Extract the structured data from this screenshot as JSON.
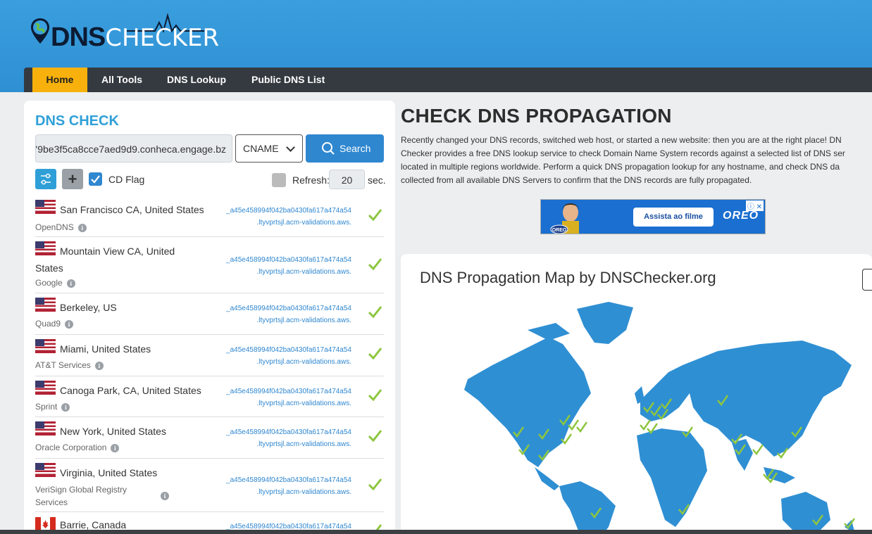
{
  "brand": {
    "dns": "DNS",
    "checker": "CHECKER"
  },
  "nav": {
    "home": "Home",
    "all_tools": "All Tools",
    "dns_lookup": "DNS Lookup",
    "public_dns_list": "Public DNS List"
  },
  "check": {
    "title": "DNS CHECK",
    "domain_value": "'9be3f5ca8cce7aed9d9.conheca.engage.bz",
    "record_type": "CNAME",
    "search_label": "Search",
    "cd_flag_label": "CD Flag",
    "cd_flag_checked": true,
    "refresh_label": "Refresh:",
    "refresh_value": "20",
    "sec_label": "sec."
  },
  "servers": [
    {
      "location": "San Francisco CA, United States",
      "provider": "OpenDNS",
      "country": "us",
      "result_line1": "_a45e458994f042ba0430fa617a474a54",
      "result_line2": ".ltyvprtsjl.acm-validations.aws.",
      "status": "ok"
    },
    {
      "location": "Mountain View CA, United States",
      "provider": "Google",
      "country": "us",
      "result_line1": "_a45e458994f042ba0430fa617a474a54",
      "result_line2": ".ltyvprtsjl.acm-validations.aws.",
      "status": "ok"
    },
    {
      "location": "Berkeley, US",
      "provider": "Quad9",
      "country": "us",
      "result_line1": "_a45e458994f042ba0430fa617a474a54",
      "result_line2": ".ltyvprtsjl.acm-validations.aws.",
      "status": "ok"
    },
    {
      "location": "Miami, United States",
      "provider": "AT&T Services",
      "country": "us",
      "result_line1": "_a45e458994f042ba0430fa617a474a54",
      "result_line2": ".ltyvprtsjl.acm-validations.aws.",
      "status": "ok"
    },
    {
      "location": "Canoga Park, CA, United States",
      "provider": "Sprint",
      "country": "us",
      "result_line1": "_a45e458994f042ba0430fa617a474a54",
      "result_line2": ".ltyvprtsjl.acm-validations.aws.",
      "status": "ok"
    },
    {
      "location": "New York, United States",
      "provider": "Oracle Corporation",
      "country": "us",
      "result_line1": "_a45e458994f042ba0430fa617a474a54",
      "result_line2": ".ltyvprtsjl.acm-validations.aws.",
      "status": "ok"
    },
    {
      "location": "Virginia, United States",
      "provider": "VeriSign Global Registry Services",
      "country": "us",
      "result_line1": "_a45e458994f042ba0430fa617a474a54",
      "result_line2": ".ltyvprtsjl.acm-validations.aws.",
      "status": "ok"
    },
    {
      "location": "Barrie, Canada",
      "provider": "",
      "country": "ca",
      "result_line1": "_a45e458994f042ba0430fa617a474a54",
      "result_line2": "",
      "status": "ok"
    }
  ],
  "main": {
    "title": "CHECK DNS PROPAGATION",
    "desc_line1": "Recently changed your DNS records, switched web host, or started a new website: then you are at the right place! DN",
    "desc_line2": "Checker provides a free DNS lookup service to check Domain Name System records against a selected list of DNS ser",
    "desc_line3": "located in multiple regions worldwide. Perform a quick DNS propagation lookup for any hostname, and check DNS da",
    "desc_line4": "collected from all available DNS Servers to confirm that the DNS records are fully propagated."
  },
  "ad": {
    "button": "Assista ao filme",
    "brand": "OREO"
  },
  "map": {
    "title": "DNS Propagation Map by DNSChecker.org"
  },
  "colors": {
    "header": "#3a9fde",
    "nav": "#343a40",
    "accent": "#f8b10c",
    "link": "#2f87d0",
    "check": "#8dc63f",
    "map_land": "#2f8fd3"
  }
}
